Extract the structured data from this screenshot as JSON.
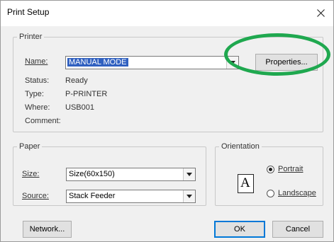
{
  "window": {
    "title": "Print Setup"
  },
  "printer": {
    "group_label": "Printer",
    "name_label": "Name:",
    "name_value": "MANUAL MODE",
    "properties_label": "Properties...",
    "status_label": "Status:",
    "status_value": "Ready",
    "type_label": "Type:",
    "type_value": "P-PRINTER",
    "where_label": "Where:",
    "where_value": "USB001",
    "comment_label": "Comment:"
  },
  "paper": {
    "group_label": "Paper",
    "size_label": "Size:",
    "size_value": "Size(60x150)",
    "source_label": "Source:",
    "source_value": "Stack Feeder"
  },
  "orientation": {
    "group_label": "Orientation",
    "icon_glyph": "A",
    "portrait_label": "Portrait",
    "landscape_label": "Landscape",
    "selected": "Portrait"
  },
  "buttons": {
    "network_label": "Network...",
    "ok_label": "OK",
    "cancel_label": "Cancel"
  },
  "colors": {
    "highlight_ring": "#1fa84f",
    "selection": "#3060c0",
    "default_button_border": "#0078d7"
  },
  "icons": {
    "close": "close-icon",
    "dropdown": "chevron-down-icon",
    "orientation": "portrait-page-icon"
  }
}
